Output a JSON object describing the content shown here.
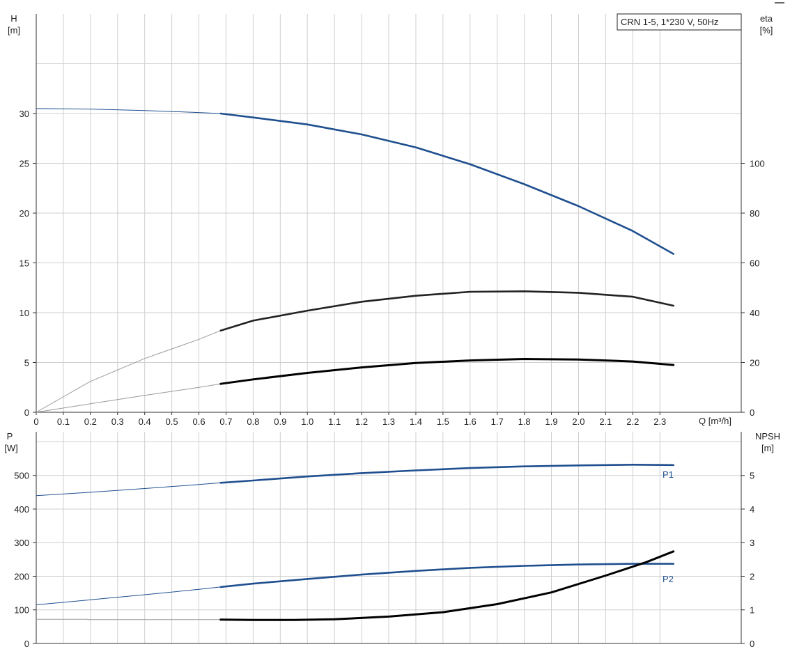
{
  "chart_data": [
    {
      "type": "line",
      "legend": "CRN 1-5, 1*230 V, 50Hz",
      "legend_position": "top-right",
      "grid": true,
      "x_axis": {
        "label": "Q [m³/h]",
        "range": [
          0,
          2.6
        ],
        "ticks": [
          "0",
          "0.1",
          "0.2",
          "0.3",
          "0.4",
          "0.5",
          "0.6",
          "0.7",
          "0.8",
          "0.9",
          "1.0",
          "1.1",
          "1.2",
          "1.3",
          "1.4",
          "1.5",
          "1.6",
          "1.7",
          "1.8",
          "1.9",
          "2.0",
          "2.1",
          "2.2",
          "2.3"
        ],
        "tick_values": [
          0,
          0.1,
          0.2,
          0.3,
          0.4,
          0.5,
          0.6,
          0.7,
          0.8,
          0.9,
          1.0,
          1.1,
          1.2,
          1.3,
          1.4,
          1.5,
          1.6,
          1.7,
          1.8,
          1.9,
          2.0,
          2.1,
          2.2,
          2.3
        ]
      },
      "y_left": {
        "label_line1": "H",
        "label_line2": "[m]",
        "range": [
          0,
          40
        ],
        "ticks": [
          "0",
          "5",
          "10",
          "15",
          "20",
          "25",
          "30"
        ],
        "tick_values": [
          0,
          5,
          10,
          15,
          20,
          25,
          30
        ]
      },
      "y_right": {
        "label_line1": "eta",
        "label_line2": "[%]",
        "range": [
          0,
          160
        ],
        "ticks": [
          "0",
          "20",
          "40",
          "60",
          "80",
          "100"
        ],
        "tick_values": [
          0,
          20,
          40,
          60,
          80,
          100
        ]
      },
      "duty_range_start_q": 0.68,
      "series": [
        {
          "id": "H",
          "axis": "left",
          "color": "#1f4f8f",
          "x": [
            0,
            0.2,
            0.4,
            0.6,
            0.68,
            0.8,
            1.0,
            1.2,
            1.4,
            1.6,
            1.8,
            2.0,
            2.2,
            2.35
          ],
          "y": [
            30.5,
            30.45,
            30.3,
            30.1,
            30.0,
            29.6,
            28.9,
            27.9,
            26.6,
            24.9,
            22.9,
            20.7,
            18.2,
            15.9
          ]
        },
        {
          "id": "eta",
          "axis": "right",
          "color": "#222222",
          "x": [
            0,
            0.2,
            0.4,
            0.6,
            0.68,
            0.8,
            1.0,
            1.2,
            1.4,
            1.6,
            1.8,
            2.0,
            2.2,
            2.35
          ],
          "y": [
            0,
            12.4,
            21.6,
            29.3,
            32.8,
            36.8,
            40.8,
            44.4,
            46.8,
            48.4,
            48.6,
            48.0,
            46.4,
            42.8
          ]
        },
        {
          "id": "eta2",
          "axis": "left",
          "color": "#000000",
          "x": [
            0,
            0.2,
            0.4,
            0.6,
            0.68,
            0.8,
            1.0,
            1.2,
            1.4,
            1.6,
            1.8,
            2.0,
            2.2,
            2.35
          ],
          "y": [
            0,
            0.85,
            1.7,
            2.5,
            2.85,
            3.3,
            3.95,
            4.5,
            4.95,
            5.2,
            5.35,
            5.3,
            5.1,
            4.75
          ]
        }
      ]
    },
    {
      "type": "line",
      "grid": true,
      "x_axis": {
        "range": [
          0,
          2.6
        ],
        "tick_values": [
          0,
          0.1,
          0.2,
          0.3,
          0.4,
          0.5,
          0.6,
          0.7,
          0.8,
          0.9,
          1.0,
          1.1,
          1.2,
          1.3,
          1.4,
          1.5,
          1.6,
          1.7,
          1.8,
          1.9,
          2.0,
          2.1,
          2.2,
          2.3
        ]
      },
      "y_left": {
        "label_line1": "P",
        "label_line2": "[W]",
        "range": [
          0,
          630
        ],
        "ticks": [
          "0",
          "100",
          "200",
          "300",
          "400",
          "500"
        ],
        "tick_values": [
          0,
          100,
          200,
          300,
          400,
          500
        ]
      },
      "y_right": {
        "label_line1": "NPSH",
        "label_line2": "[m]",
        "range": [
          0,
          6.3
        ],
        "ticks": [
          "0",
          "1",
          "2",
          "3",
          "4",
          "5"
        ],
        "tick_values": [
          0,
          1,
          2,
          3,
          4,
          5
        ]
      },
      "duty_range_start_q": 0.68,
      "series": [
        {
          "id": "P1",
          "name": "P1",
          "axis": "left",
          "color": "#1f4f8f",
          "x": [
            0,
            0.2,
            0.4,
            0.6,
            0.68,
            0.8,
            1.0,
            1.2,
            1.4,
            1.6,
            1.8,
            2.0,
            2.2,
            2.35
          ],
          "y": [
            440,
            450,
            461,
            473,
            478,
            485,
            497,
            507,
            515,
            522,
            527,
            530,
            532,
            531
          ]
        },
        {
          "id": "P2",
          "name": "P2",
          "axis": "left",
          "color": "#1f4f8f",
          "x": [
            0,
            0.2,
            0.4,
            0.6,
            0.68,
            0.8,
            1.0,
            1.2,
            1.4,
            1.6,
            1.8,
            2.0,
            2.2,
            2.35
          ],
          "y": [
            115,
            130,
            145,
            161,
            168,
            178,
            192,
            205,
            216,
            225,
            231,
            235,
            237,
            237
          ]
        },
        {
          "id": "NPSH",
          "axis": "right",
          "color": "#000000",
          "x": [
            0,
            0.19,
            0.19,
            0.68,
            0.8,
            0.95,
            1.1,
            1.3,
            1.5,
            1.7,
            1.9,
            2.1,
            2.25,
            2.35
          ],
          "y": [
            0.72,
            0.72,
            0.71,
            0.71,
            0.7,
            0.7,
            0.72,
            0.8,
            0.93,
            1.17,
            1.52,
            2.02,
            2.42,
            2.74
          ]
        }
      ]
    }
  ]
}
